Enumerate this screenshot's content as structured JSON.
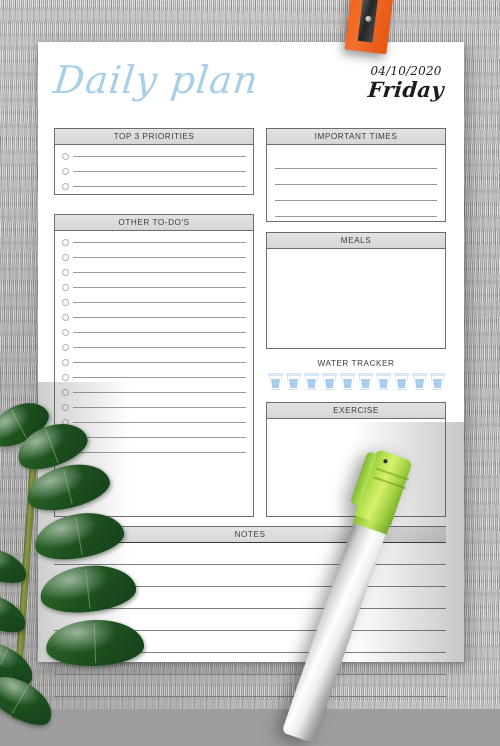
{
  "page": {
    "title": "Daily plan",
    "date": "04/10/2020",
    "weekday": "Friday",
    "accent_blue": "#a8cfe8",
    "header_gray": "#dcdcdc",
    "border_gray": "#6d6d6d",
    "rule_gray": "#9a9a9a",
    "background": "gray-weathered-wood"
  },
  "sections": {
    "top_priorities": {
      "title": "TOP 3 PRIORITIES",
      "row_count": 3,
      "has_bullets": true
    },
    "other_todos": {
      "title": "OTHER TO-DO'S",
      "row_count": 15,
      "has_bullets": true
    },
    "important_times": {
      "title": "IMPORTANT TIMES",
      "row_count": 5,
      "has_bullets": false
    },
    "meals": {
      "title": "MEALS",
      "row_count": 0,
      "has_bullets": false
    },
    "water_tracker": {
      "title": "WATER TRACKER",
      "glass_count": 10,
      "glass_fill_color": "#a9cdea"
    },
    "exercise": {
      "title": "EXERCISE",
      "row_count": 0,
      "has_bullets": false
    },
    "notes": {
      "title": "NOTES",
      "row_count": 7,
      "has_bullets": false
    }
  },
  "decorations": {
    "clip": "orange-pencil-sharpener-clip",
    "pen": "green-white-marker-pen",
    "plant": "zz-plant-branch-leaves"
  }
}
